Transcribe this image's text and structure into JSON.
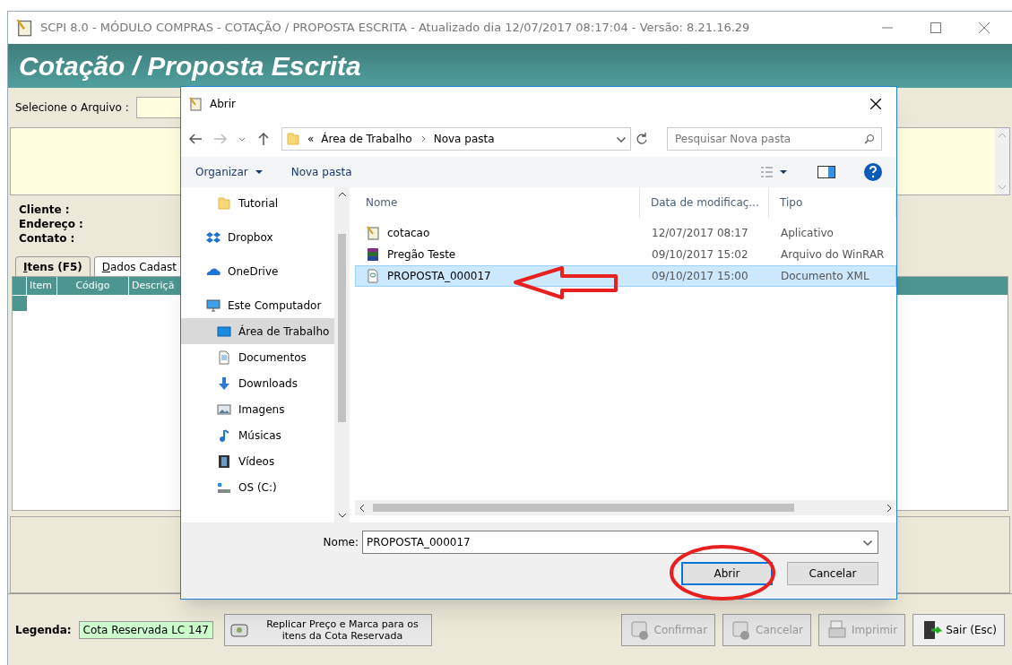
{
  "window": {
    "title": "SCPI 8.0 - MÓDULO COMPRAS - COTAÇÃO / PROPOSTA ESCRITA - Atualizado dia 12/07/2017 08:17:04 - Versão: 8.21.16.29"
  },
  "header": {
    "title": "Cotação / Proposta Escrita"
  },
  "file_select": {
    "label": "Selecione o Arquivo :"
  },
  "client_info": [
    "Cliente :",
    "Endereço :",
    "Contato :"
  ],
  "tabs": [
    {
      "label": "Itens (F5)",
      "selected": true
    },
    {
      "label": "Dados Cadast",
      "selected": false
    }
  ],
  "grid": {
    "columns": [
      "Item",
      "Código",
      "Descriçã"
    ]
  },
  "legend": {
    "label": "Legenda:",
    "items": [
      {
        "text": "Cota Reservada LC 147",
        "color": "#ccffcc"
      }
    ]
  },
  "replicate_button": {
    "label": "Replicar Preço e Marca para os itens da Cota Reservada"
  },
  "actions": [
    {
      "label": "Confirmar",
      "kind": "confirm",
      "disabled": true
    },
    {
      "label": "Cancelar",
      "kind": "cancel",
      "disabled": true
    },
    {
      "label": "Imprimir",
      "kind": "print",
      "disabled": true
    },
    {
      "label": "Sair (Esc)",
      "kind": "exit",
      "disabled": false
    }
  ],
  "dialog": {
    "title": "Abrir",
    "breadcrumb": [
      "«",
      "Área de Trabalho",
      "Nova pasta"
    ],
    "search": {
      "placeholder": "Pesquisar Nova pasta"
    },
    "toolbar": [
      "Organizar",
      "Nova pasta"
    ],
    "nav": [
      {
        "label": "Tutorial",
        "kind": "folder",
        "indent": true,
        "selected": false
      },
      {
        "label": "Dropbox",
        "kind": "dropbox",
        "indent": false,
        "selected": false
      },
      {
        "label": "OneDrive",
        "kind": "cloud",
        "indent": false,
        "selected": false
      },
      {
        "label": "Este Computador",
        "kind": "computer",
        "indent": false,
        "selected": false
      },
      {
        "label": "Área de Trabalho",
        "kind": "desktop",
        "indent": true,
        "selected": true
      },
      {
        "label": "Documentos",
        "kind": "document",
        "indent": true,
        "selected": false
      },
      {
        "label": "Downloads",
        "kind": "download",
        "indent": true,
        "selected": false
      },
      {
        "label": "Imagens",
        "kind": "image",
        "indent": true,
        "selected": false
      },
      {
        "label": "Músicas",
        "kind": "music",
        "indent": true,
        "selected": false
      },
      {
        "label": "Vídeos",
        "kind": "video",
        "indent": true,
        "selected": false
      },
      {
        "label": "OS (C:)",
        "kind": "drive",
        "indent": true,
        "selected": false
      }
    ],
    "columns": [
      "Nome",
      "Data de modificaç...",
      "Tipo"
    ],
    "files": [
      {
        "name": "cotacao",
        "date": "12/07/2017 08:17",
        "type": "Aplicativo",
        "kind": "app",
        "selected": false
      },
      {
        "name": "Pregão Teste",
        "date": "09/10/2017 15:02",
        "type": "Arquivo do WinRAR",
        "kind": "archive",
        "selected": false
      },
      {
        "name": "PROPOSTA_000017",
        "date": "09/10/2017 15:00",
        "type": "Documento XML",
        "kind": "xml",
        "selected": true
      }
    ],
    "filename": {
      "label": "Nome:",
      "value": "PROPOSTA_000017"
    },
    "buttons": [
      "Abrir",
      "Cancelar"
    ]
  }
}
